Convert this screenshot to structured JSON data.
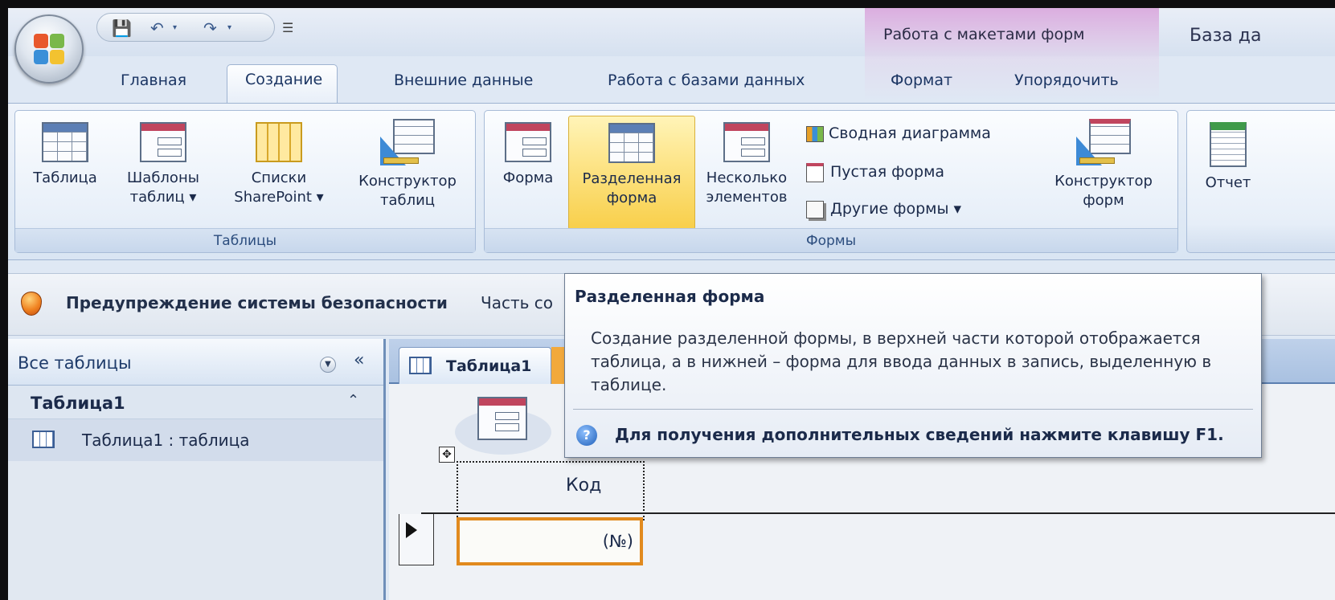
{
  "titlebar": {
    "context_group": "Работа с макетами форм",
    "app_title": "База да"
  },
  "tabs": [
    "Главная",
    "Создание",
    "Внешние данные",
    "Работа с базами данных",
    "Формат",
    "Упорядочить"
  ],
  "ribbon": {
    "tables_group": {
      "label": "Таблицы",
      "buttons": [
        {
          "line1": "Таблица",
          "line2": ""
        },
        {
          "line1": "Шаблоны",
          "line2": "таблиц ▾"
        },
        {
          "line1": "Списки",
          "line2": "SharePoint ▾"
        },
        {
          "line1": "Конструктор",
          "line2": "таблиц"
        }
      ]
    },
    "forms_group": {
      "label": "Формы",
      "buttons": [
        {
          "line1": "Форма",
          "line2": ""
        },
        {
          "line1": "Разделенная",
          "line2": "форма"
        },
        {
          "line1": "Несколько",
          "line2": "элементов"
        },
        {
          "line1": "Конструктор",
          "line2": "форм"
        }
      ],
      "small": [
        "Сводная диаграмма",
        "Пустая форма",
        "Другие формы ▾"
      ]
    },
    "reports_group": {
      "buttons": [
        {
          "line1": "Отчет"
        }
      ]
    }
  },
  "security": {
    "title": "Предупреждение системы безопасности",
    "text": "Часть со"
  },
  "nav": {
    "title": "Все таблицы",
    "collapse": "«",
    "group_title": "Таблица1",
    "group_toggle": "⌃",
    "item": "Таблица1 : таблица"
  },
  "doc": {
    "tab_label": "Таблица1",
    "field_label": "Код",
    "field_value": "(№)"
  },
  "tooltip": {
    "title": "Разделенная форма",
    "body": "Создание разделенной формы, в верхней части которой отображается таблица, а в нижней – форма для ввода данных в запись, выделенную в таблице.",
    "help": "Для получения дополнительных сведений нажмите клавишу F1."
  },
  "icons": {
    "office_button": "office-logo-icon",
    "save": "save-icon",
    "undo": "undo-icon",
    "redo": "redo-icon",
    "shield": "shield-icon",
    "help": "help-icon"
  },
  "colors": {
    "accent_orange": "#e18a1e",
    "context_tab": "#daaade",
    "ribbon_blue": "#dfe8f4"
  }
}
